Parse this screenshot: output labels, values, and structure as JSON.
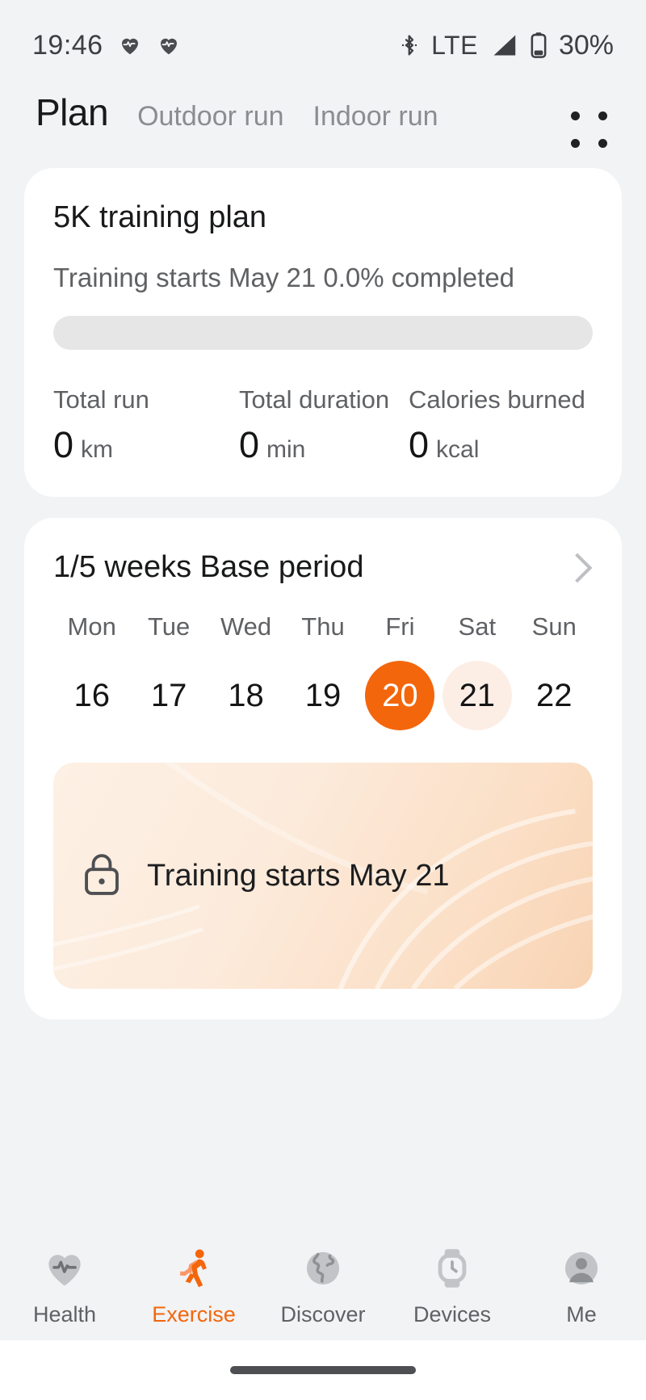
{
  "status_bar": {
    "time": "19:46",
    "icons": [
      "heart-rate-icon",
      "heart-rate-icon"
    ],
    "bluetooth": "bluetooth-icon",
    "network": "LTE",
    "signal": "signal-bars-icon",
    "battery_icon": "battery-icon",
    "battery": "30%"
  },
  "header": {
    "active_tab": "Plan",
    "tabs": [
      "Outdoor run",
      "Indoor run"
    ],
    "menu_icon": "grid-dots-menu-icon"
  },
  "plan_card": {
    "title": "5K training plan",
    "subtitle": "Training starts May 21 0.0% completed",
    "progress_percent": 0,
    "stats": [
      {
        "label": "Total run",
        "value": "0",
        "unit": "km"
      },
      {
        "label": "Total duration",
        "value": "0",
        "unit": "min"
      },
      {
        "label": "Calories burned",
        "value": "0",
        "unit": "kcal"
      }
    ]
  },
  "week_card": {
    "title": "1/5 weeks Base period",
    "chevron_icon": "chevron-right-icon",
    "weekdays": [
      "Mon",
      "Tue",
      "Wed",
      "Thu",
      "Fri",
      "Sat",
      "Sun"
    ],
    "dates": [
      {
        "day": "16",
        "state": "normal"
      },
      {
        "day": "17",
        "state": "normal"
      },
      {
        "day": "18",
        "state": "normal"
      },
      {
        "day": "19",
        "state": "normal"
      },
      {
        "day": "20",
        "state": "selected"
      },
      {
        "day": "21",
        "state": "highlight"
      },
      {
        "day": "22",
        "state": "normal"
      }
    ],
    "banner": {
      "lock_icon": "lock-icon",
      "text": "Training starts May 21"
    }
  },
  "bottom_nav": {
    "items": [
      {
        "label": "Health",
        "icon": "heart-pulse-icon",
        "active": false
      },
      {
        "label": "Exercise",
        "icon": "running-person-icon",
        "active": true
      },
      {
        "label": "Discover",
        "icon": "globe-icon",
        "active": false
      },
      {
        "label": "Devices",
        "icon": "watch-icon",
        "active": false
      },
      {
        "label": "Me",
        "icon": "person-avatar-icon",
        "active": false
      }
    ]
  },
  "colors": {
    "accent": "#f4660c",
    "accent_soft": "#fdeee5",
    "page_bg": "#f1f3f4",
    "card_bg": "#ffffff",
    "text_primary": "#18191a",
    "text_secondary": "#5f6164"
  }
}
